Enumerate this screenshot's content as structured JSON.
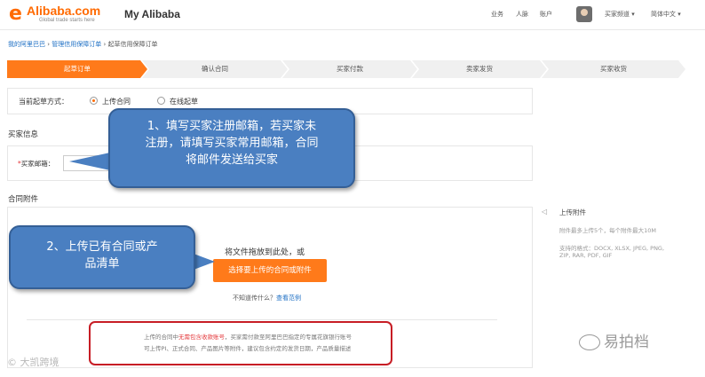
{
  "header": {
    "logo_mark": "e",
    "logo_brand": "Alibaba.com",
    "logo_tagline": "Global trade starts here",
    "title": "My Alibaba",
    "nav": [
      "业务",
      "人脉",
      "账户"
    ],
    "account_menu": "买家频道 ▾",
    "language": "简体中文 ▾"
  },
  "breadcrumb": {
    "home": "我的阿里巴巴",
    "manage": "管理信用保障订单",
    "current": "起草信用保障订单",
    "separator": "›"
  },
  "steps": [
    "起草订单",
    "确认合同",
    "买家付款",
    "卖家发货",
    "买家收货"
  ],
  "mode": {
    "label": "当前起草方式：",
    "options": [
      "上传合同",
      "在线起草"
    ],
    "selected": "上传合同"
  },
  "buyer_info": {
    "title": "买家信息",
    "required_mark": "*",
    "email_label": "买家邮箱：",
    "email_value": ""
  },
  "attachments": {
    "title": "合同附件",
    "drop_text": "将文件拖放到此处，或",
    "upload_button": "选择要上传的合同或附件",
    "hint_prefix": "不知道传什么？",
    "hint_link": "查看范例",
    "notice_line1_a": "上传的合同中",
    "notice_line1_red": "无需包含收款账号",
    "notice_line1_b": "，买家需付款至阿里巴巴指定的专属花旗银行账号",
    "notice_line2": "可上传PI、正式合同、产品图片等附件，建议包含约定的发货日期，产品质量描述"
  },
  "sidebar": {
    "title": "上传附件",
    "lines": [
      "附件最多上传5个，每个附件最大10M",
      "支持的格式：DOCX, XLSX, JPEG, PNG,",
      "ZIP, RAR, PDF, GIF"
    ]
  },
  "callouts": {
    "first": [
      "1、填写买家注册邮箱，若买家未",
      "注册，请填写买家常用邮箱，合同",
      "将邮件发送给买家"
    ],
    "second": [
      "2、上传已有合同或产",
      "品清单"
    ]
  },
  "watermarks": {
    "left": "© 大凯跨境",
    "right": "易拍档"
  },
  "colors": {
    "accent": "#ff7a1a",
    "callout": "#4a7fc1",
    "notice_border": "#c71d25",
    "link": "#1d6fc4"
  }
}
